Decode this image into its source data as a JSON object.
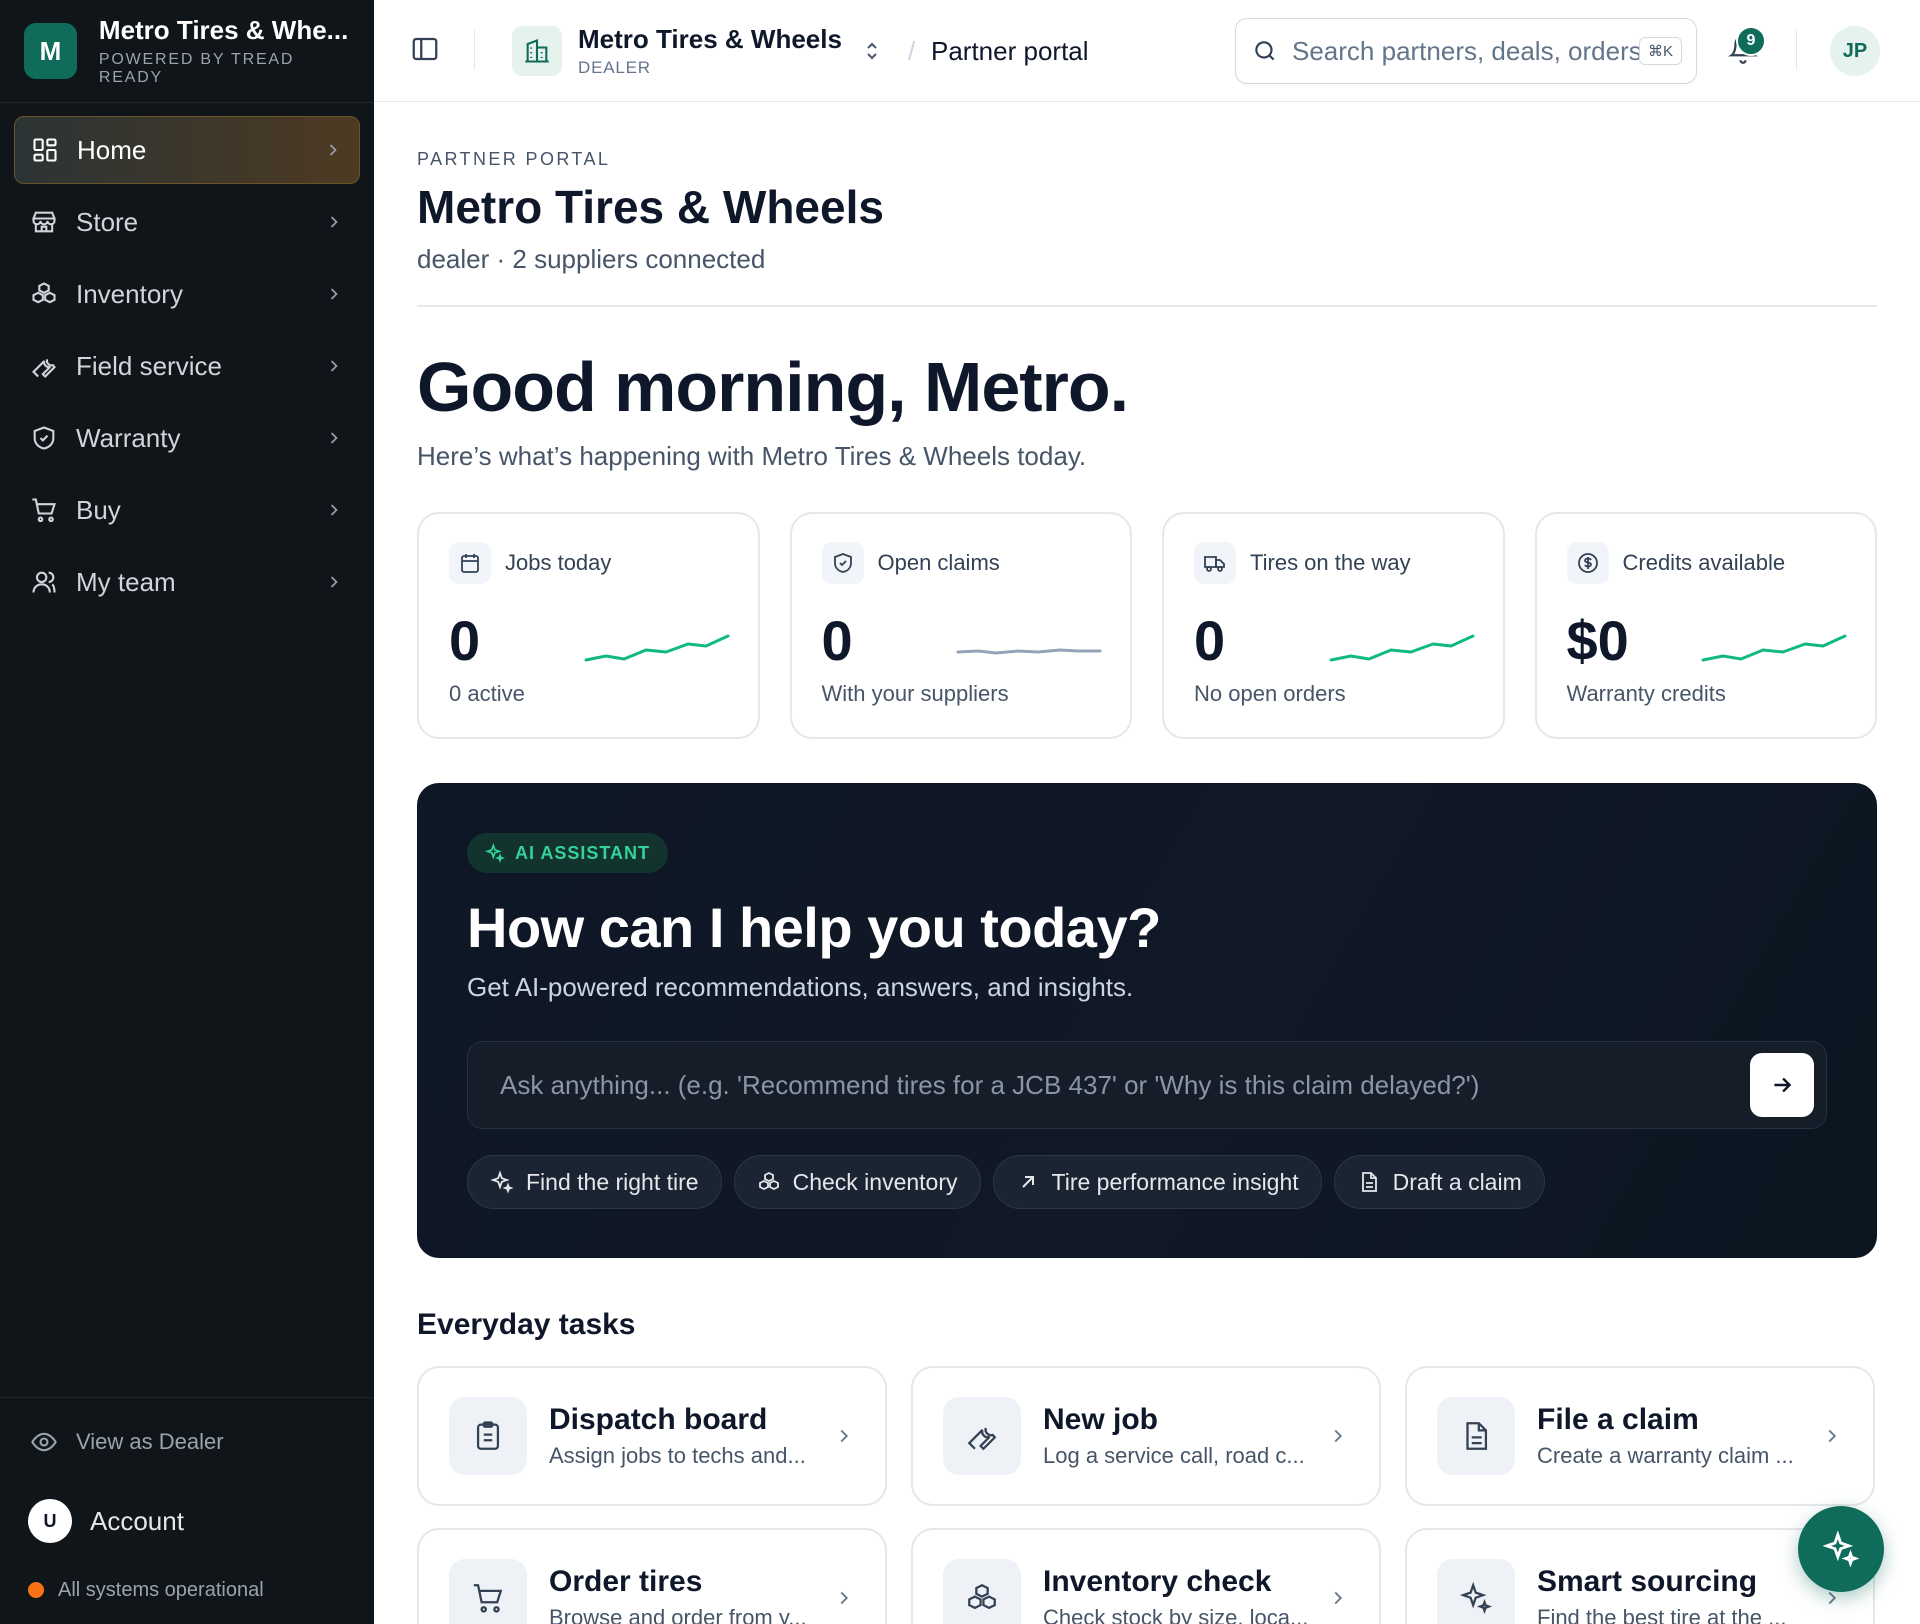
{
  "brand": {
    "logo_letter": "M",
    "name": "Metro Tires & Whe...",
    "tagline": "POWERED BY TREAD READY",
    "accent": "#0f6b5a"
  },
  "sidebar": {
    "items": [
      {
        "label": "Home",
        "icon": "grid-icon",
        "active": true
      },
      {
        "label": "Store",
        "icon": "store-icon"
      },
      {
        "label": "Inventory",
        "icon": "boxes-icon"
      },
      {
        "label": "Field service",
        "icon": "wrench-icon"
      },
      {
        "label": "Warranty",
        "icon": "shield-check-icon"
      },
      {
        "label": "Buy",
        "icon": "cart-icon"
      },
      {
        "label": "My team",
        "icon": "users-icon"
      }
    ],
    "view_as": "View as Dealer",
    "account_initial": "U",
    "account_label": "Account",
    "status": "All systems operational",
    "status_color": "#f97316"
  },
  "topbar": {
    "org_name": "Metro Tires & Wheels",
    "org_type": "DEALER",
    "breadcrumb_separator": "/",
    "breadcrumb_page": "Partner portal",
    "search_placeholder": "Search partners, deals, orders",
    "search_shortcut": "⌘K",
    "notifications_count": "9",
    "user_initials": "JP"
  },
  "header": {
    "eyebrow": "PARTNER PORTAL",
    "title": "Metro Tires & Wheels",
    "subtitle": "dealer · 2 suppliers connected",
    "greeting": "Good morning, Metro.",
    "greeting_sub": "Here’s what’s happening with Metro Tires & Wheels today."
  },
  "stats": [
    {
      "label": "Jobs today",
      "value": "0",
      "caption": "0 active",
      "icon": "calendar-icon",
      "trend": "up",
      "trend_color": "#10b981"
    },
    {
      "label": "Open claims",
      "value": "0",
      "caption": "With your suppliers",
      "icon": "shield-icon",
      "trend": "flat",
      "trend_color": "#94a3b8"
    },
    {
      "label": "Tires on the way",
      "value": "0",
      "caption": "No open orders",
      "icon": "truck-icon",
      "trend": "up",
      "trend_color": "#10b981"
    },
    {
      "label": "Credits available",
      "value": "$0",
      "caption": "Warranty credits",
      "icon": "dollar-icon",
      "trend": "up",
      "trend_color": "#10b981"
    }
  ],
  "ai": {
    "chip": "AI ASSISTANT",
    "title": "How can I help you today?",
    "subtitle": "Get AI-powered recommendations, answers, and insights.",
    "placeholder": "Ask anything... (e.g. 'Recommend tires for a JCB 437' or 'Why is this claim delayed?')",
    "suggestions": [
      {
        "label": "Find the right tire",
        "icon": "sparkles-icon"
      },
      {
        "label": "Check inventory",
        "icon": "boxes-icon"
      },
      {
        "label": "Tire performance insight",
        "icon": "arrow-up-right-icon"
      },
      {
        "label": "Draft a claim",
        "icon": "file-icon"
      }
    ]
  },
  "tasks": {
    "title": "Everyday tasks",
    "items": [
      {
        "title": "Dispatch board",
        "desc": "Assign jobs to techs and...",
        "icon": "clipboard-icon"
      },
      {
        "title": "New job",
        "desc": "Log a service call, road c...",
        "icon": "wrench-icon"
      },
      {
        "title": "File a claim",
        "desc": "Create a warranty claim ...",
        "icon": "file-icon"
      },
      {
        "title": "Order tires",
        "desc": "Browse and order from y...",
        "icon": "cart-icon"
      },
      {
        "title": "Inventory check",
        "desc": "Check stock by size, loca...",
        "icon": "boxes-icon"
      },
      {
        "title": "Smart sourcing",
        "desc": "Find the best tire at the ...",
        "icon": "sparkles-icon"
      }
    ]
  }
}
